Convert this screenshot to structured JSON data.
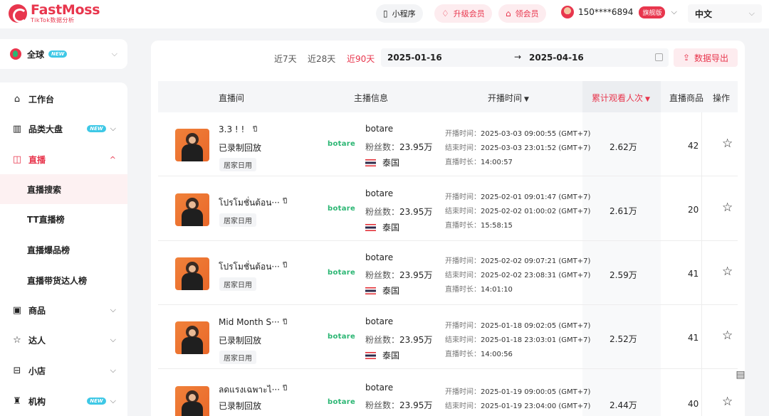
{
  "app": {
    "brand": "FastMoss",
    "subtitle": "TikTok数据分析"
  },
  "header": {
    "mini_program": "小程序",
    "upgrade": "升级会员",
    "get_vip": "领会员",
    "user_phone": "150****6894",
    "user_badge": "旗舰版",
    "language": "中文"
  },
  "sidebar": {
    "region": "全球",
    "region_badge": "NEW",
    "items": [
      {
        "label": "工作台",
        "icon": "home-icon"
      },
      {
        "label": "品类大盘",
        "icon": "bar-chart-icon",
        "badge": "NEW"
      },
      {
        "label": "直播",
        "icon": "live-tv-icon"
      },
      {
        "label": "商品",
        "icon": "bag-icon"
      },
      {
        "label": "达人",
        "icon": "star-person-icon"
      },
      {
        "label": "小店",
        "icon": "shop-icon"
      },
      {
        "label": "机构",
        "icon": "org-icon",
        "badge": "NEW"
      }
    ],
    "live_sub": [
      "直播搜索",
      "TT直播榜",
      "直播爆品榜",
      "直播带货达人榜"
    ]
  },
  "filters": {
    "ranges": [
      "近7天",
      "近28天",
      "近90天"
    ],
    "start_date": "2025-01-16",
    "end_date": "2025-04-16",
    "arrow": "→",
    "export": "数据导出"
  },
  "table": {
    "columns": [
      "直播间",
      "主播信息",
      "开播时间",
      "累计观看人次",
      "直播商品",
      "操作"
    ],
    "time_labels": {
      "start": "开播时间：",
      "end": "结束时间：",
      "duration": "直播时长："
    },
    "fans_label": "粉丝数：",
    "brand_label": "botare",
    "flag_mark": "ปี",
    "rows": [
      {
        "title": "3.3 ! !",
        "status": "已录制回放",
        "tag": "居家日用",
        "host": "botare",
        "fans": "23.95万",
        "country": "泰国",
        "start": "2025-03-03 09:00:55 (GMT+7)",
        "end": "2025-03-03 23:01:52 (GMT+7)",
        "duration": "14:00:57",
        "views": "2.62万",
        "goods": "42"
      },
      {
        "title": "โปรโมชั่นต้อน···",
        "status": "",
        "tag": "居家日用",
        "host": "botare",
        "fans": "23.95万",
        "country": "泰国",
        "start": "2025-02-01 09:01:47 (GMT+7)",
        "end": "2025-02-02 01:00:02 (GMT+7)",
        "duration": "15:58:15",
        "views": "2.61万",
        "goods": "20"
      },
      {
        "title": "โปรโมชั่นต้อน···",
        "status": "",
        "tag": "居家日用",
        "host": "botare",
        "fans": "23.95万",
        "country": "泰国",
        "start": "2025-02-02 09:07:21 (GMT+7)",
        "end": "2025-02-02 23:08:31 (GMT+7)",
        "duration": "14:01:10",
        "views": "2.59万",
        "goods": "41"
      },
      {
        "title": "Mid Month S···",
        "status": "已录制回放",
        "tag": "居家日用",
        "host": "botare",
        "fans": "23.95万",
        "country": "泰国",
        "start": "2025-01-18 09:02:05 (GMT+7)",
        "end": "2025-01-18 23:03:01 (GMT+7)",
        "duration": "14:00:56",
        "views": "2.52万",
        "goods": "41"
      },
      {
        "title": "ลดแรงเฉพาะไ···",
        "status": "已录制回放",
        "tag": "",
        "host": "botare",
        "fans": "23.95万",
        "country": "泰国",
        "start": "2025-01-19 09:00:05 (GMT+7)",
        "end": "2025-01-19 23:04:00 (GMT+7)",
        "duration": "",
        "views": "2.44万",
        "goods": "40"
      }
    ]
  },
  "colors": {
    "accent": "#e8364d",
    "brand_green": "#2bb673",
    "new_badge": "#3ec8e6"
  }
}
